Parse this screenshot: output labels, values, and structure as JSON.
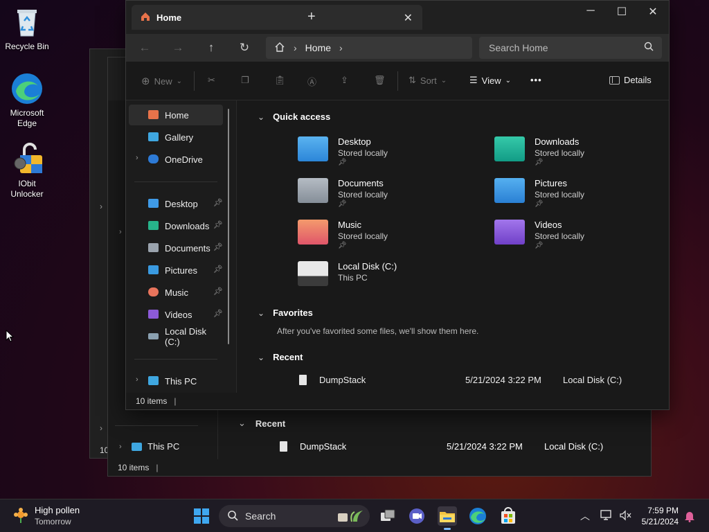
{
  "desktop": {
    "icons": [
      {
        "label": "Recycle Bin"
      },
      {
        "label": "Microsoft Edge"
      },
      {
        "label": "IObit Unlocker"
      }
    ]
  },
  "window": {
    "tab_title": "Home",
    "close_tab": "✕",
    "new_tab": "+",
    "minimize": "─",
    "maximize": "☐",
    "close": "✕"
  },
  "nav": {
    "back": "←",
    "forward": "→",
    "up": "↑",
    "refresh": "↻",
    "breadcrumb": [
      "Home"
    ],
    "search_placeholder": "Search Home"
  },
  "toolbar": {
    "new": "New",
    "sort": "Sort",
    "view": "View",
    "more": "•••",
    "details": "Details"
  },
  "sidebar": {
    "top": [
      {
        "label": "Home",
        "color": "#e8734a",
        "selected": true
      },
      {
        "label": "Gallery",
        "color": "#3fa7e0"
      },
      {
        "label": "OneDrive",
        "color": "#2d7ad6",
        "expandable": true
      }
    ],
    "pinned": [
      {
        "label": "Desktop",
        "color": "#3f9be8"
      },
      {
        "label": "Downloads",
        "color": "#27b38a"
      },
      {
        "label": "Documents",
        "color": "#9aa3ad"
      },
      {
        "label": "Pictures",
        "color": "#3a9ae0"
      },
      {
        "label": "Music",
        "color": "#e8745c"
      },
      {
        "label": "Videos",
        "color": "#8c5ad8"
      },
      {
        "label": "Local Disk (C:)",
        "color": "#8aa0b0"
      }
    ],
    "bottom": [
      {
        "label": "This PC",
        "color": "#3fa7e0"
      }
    ]
  },
  "main": {
    "quick_access_title": "Quick access",
    "quick_access": [
      {
        "name": "Desktop",
        "sub": "Stored locally",
        "color": "#3f9be8"
      },
      {
        "name": "Downloads",
        "sub": "Stored locally",
        "color": "#22b39a"
      },
      {
        "name": "Documents",
        "sub": "Stored locally",
        "color": "#9aa3ad"
      },
      {
        "name": "Pictures",
        "sub": "Stored locally",
        "color": "#3a9ae0"
      },
      {
        "name": "Music",
        "sub": "Stored locally",
        "color": "#e8745c"
      },
      {
        "name": "Videos",
        "sub": "Stored locally",
        "color": "#8c5ad8"
      },
      {
        "name": "Local Disk (C:)",
        "sub": "This PC",
        "color": "#8aa0b0"
      }
    ],
    "favorites_title": "Favorites",
    "favorites_empty": "After you've favorited some files, we'll show them here.",
    "recent_title": "Recent",
    "recent": [
      {
        "name": "DumpStack",
        "date": "5/21/2024 3:22 PM",
        "location": "Local Disk (C:)"
      }
    ]
  },
  "status": {
    "items": "10 items"
  },
  "back_window": {
    "recent_title": "Recent",
    "recent_name": "DumpStack",
    "recent_date": "5/21/2024 3:22 PM",
    "recent_location": "Local Disk (C:)",
    "this_pc": "This PC",
    "items": "10 items"
  },
  "taskbar": {
    "weather_title": "High pollen",
    "weather_sub": "Tomorrow",
    "search": "Search",
    "time": "7:59 PM",
    "date": "5/21/2024"
  }
}
